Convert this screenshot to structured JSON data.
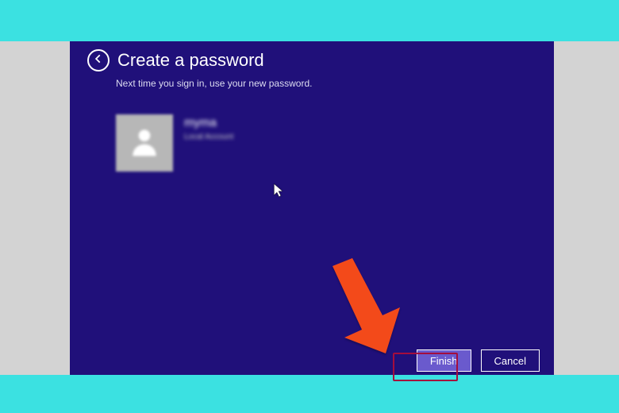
{
  "header": {
    "title": "Create a password",
    "subtitle": "Next time you sign in, use your new password."
  },
  "user": {
    "name": "myma",
    "type": "Local Account"
  },
  "buttons": {
    "finish": "Finish",
    "cancel": "Cancel"
  },
  "colors": {
    "teal": "#3be1e1",
    "windowBg": "#20107a",
    "highlight": "#a30d3d",
    "arrow": "#f34a1a",
    "finishBg": "#6a5acd"
  }
}
